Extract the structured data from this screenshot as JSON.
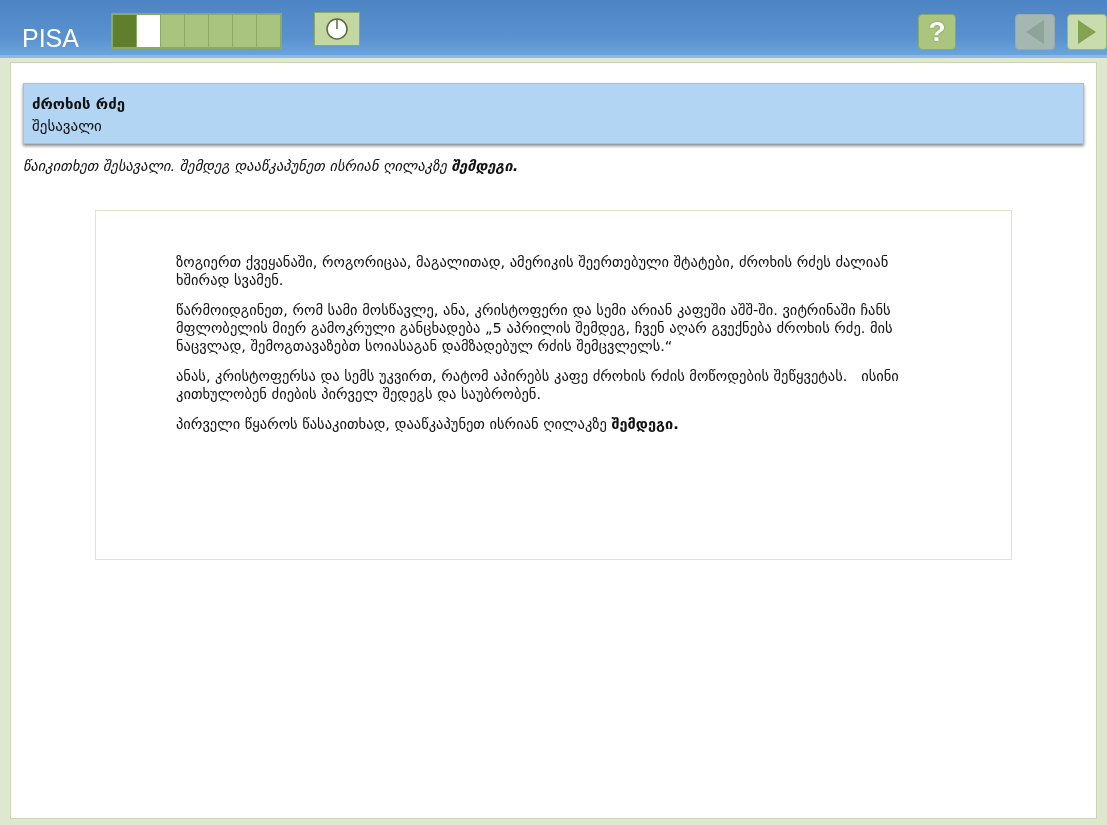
{
  "header": {
    "logo": "PISA",
    "progress": [
      {
        "kind": "done"
      },
      {
        "kind": "current"
      },
      {
        "kind": "todo"
      },
      {
        "kind": "todo"
      },
      {
        "kind": "todo"
      },
      {
        "kind": "todo"
      },
      {
        "kind": "todo"
      }
    ],
    "help_button": {
      "label": "?"
    },
    "back_button": {
      "disabled": true
    },
    "next_button": {
      "disabled": false
    }
  },
  "unit": {
    "title": "ძროხის რძე",
    "subtitle": "შესავალი"
  },
  "instruction": "წაიკითხეთ შესავალი. შემდეგ დააწკაპუნეთ ისრიან ღილაკზე **შემდეგი.**",
  "paragraphs": [
    "ზოგიერთ ქვეყანაში, როგორიცაა, მაგალითად, ამერიკის შეერთებული შტატები, ძროხის რძეს ძალიან ხშირად სვამენ.",
    "წარმოიდგინეთ, რომ სამი მოსწავლე, ანა, კრისტოფერი და სემი არიან კაფეში აშშ-ში. ვიტრინაში ჩანს მფლობელის მიერ გამოკრული განცხადება „5 აპრილის შემდეგ, ჩვენ აღარ გვექნება ძროხის რძე. მის ნაცვლად, შემოგთავაზებთ სოიასაგან დამზადებულ რძის შემცვლელს.“",
    "ანას, კრისტოფერსა და სემს უკვირთ, რატომ აპირებს კაფე ძროხის რძის მოწოდების შეწყვეტას.   ისინი კითხულობენ ძიების პირველ შედეგს და საუბრობენ.",
    "პირველი წყაროს წასაკითხად, დააწკაპუნეთ ისრიან ღილაკზე **შემდეგი.**"
  ]
}
